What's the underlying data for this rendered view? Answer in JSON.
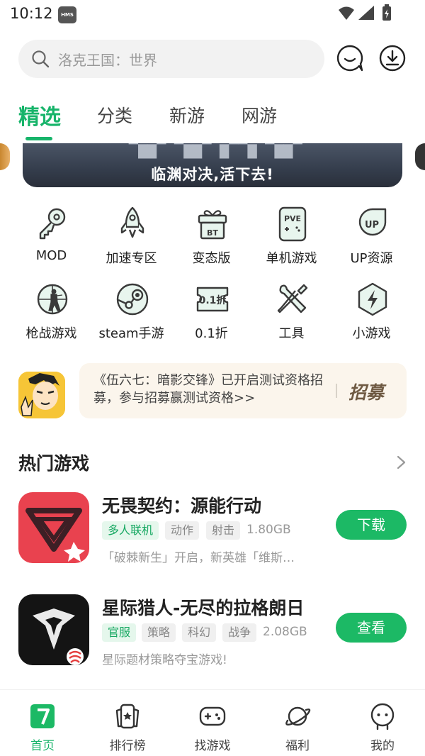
{
  "status_bar": {
    "time": "10:12",
    "hms": "HMS"
  },
  "search": {
    "placeholder": "洛克王国：世界"
  },
  "tabs": [
    {
      "label": "精选",
      "active": true
    },
    {
      "label": "分类",
      "active": false
    },
    {
      "label": "新游",
      "active": false
    },
    {
      "label": "网游",
      "active": false
    }
  ],
  "banner": {
    "caption": "临渊对决,活下去!"
  },
  "grid": [
    {
      "label": "MOD",
      "icon": "key-icon"
    },
    {
      "label": "加速专区",
      "icon": "rocket-icon"
    },
    {
      "label": "变态版",
      "icon": "gift-bt-icon",
      "badge": "BT"
    },
    {
      "label": "单机游戏",
      "icon": "pve-card-icon",
      "badge": "PVE"
    },
    {
      "label": "UP资源",
      "icon": "up-icon",
      "badge": "UP"
    },
    {
      "label": "枪战游戏",
      "icon": "soldier-target-icon"
    },
    {
      "label": "steam手游",
      "icon": "steam-icon"
    },
    {
      "label": "0.1折",
      "icon": "coupon-icon",
      "badge": "0.1折"
    },
    {
      "label": "工具",
      "icon": "tools-icon"
    },
    {
      "label": "小游戏",
      "icon": "lightning-hex-icon"
    }
  ],
  "notice": {
    "text": "《伍六七：暗影交锋》已开启测试资格招募，参与招募赢测试资格>>",
    "tag": "招募"
  },
  "hot_section": {
    "title": "热门游戏"
  },
  "games": [
    {
      "title": "无畏契约：源能行动",
      "tags": [
        "多人联机",
        "动作",
        "射击"
      ],
      "size": "1.80GB",
      "desc": "「破棘新生」开启，新英雄「维斯…",
      "button": "下载"
    },
    {
      "title": "星际猎人-无尽的拉格朗日",
      "tags": [
        "官服",
        "策略",
        "科幻",
        "战争"
      ],
      "size": "2.08GB",
      "desc": "星际题材策略夺宝游戏!",
      "button": "查看"
    }
  ],
  "bottom_nav": [
    {
      "label": "首页",
      "active": true
    },
    {
      "label": "排行榜",
      "active": false
    },
    {
      "label": "找游戏",
      "active": false
    },
    {
      "label": "福利",
      "active": false
    },
    {
      "label": "我的",
      "active": false
    }
  ],
  "colors": {
    "accent": "#17b46a",
    "button": "#1cb965",
    "notice_bg": "#fbf5ec"
  }
}
